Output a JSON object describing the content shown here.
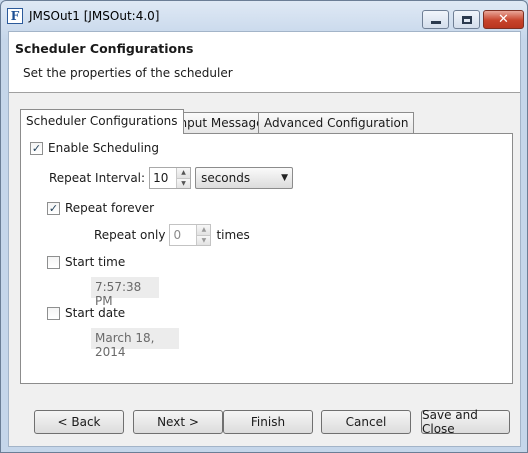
{
  "window": {
    "title": "JMSOut1 [JMSOut:4.0]",
    "app_icon_letter": "F"
  },
  "header": {
    "title": "Scheduler Configurations",
    "subtitle": "Set the properties of the scheduler"
  },
  "tabs": [
    {
      "label": "Scheduler Configurations",
      "active": true
    },
    {
      "label": "Input Message",
      "active": false
    },
    {
      "label": "Advanced Configuration",
      "active": false
    }
  ],
  "scheduler": {
    "enable_label": "Enable Scheduling",
    "enable_checked": true,
    "repeat_interval_label": "Repeat Interval:",
    "repeat_interval_value": "10",
    "interval_unit": "seconds",
    "repeat_forever_label": "Repeat forever",
    "repeat_forever_checked": true,
    "repeat_only_label": "Repeat only",
    "repeat_only_value": "0",
    "times_label": "times",
    "start_time_label": "Start time",
    "start_time_checked": false,
    "start_time_value": "7:57:38 PM",
    "start_date_label": "Start date",
    "start_date_checked": false,
    "start_date_value": "March 18, 2014"
  },
  "buttons": {
    "back": "< Back",
    "next": "Next >",
    "finish": "Finish",
    "cancel": "Cancel",
    "save_close": "Save and Close"
  },
  "glyphs": {
    "check": "✓",
    "close": "✕",
    "up": "▲",
    "down": "▼",
    "dropdown": "▼"
  }
}
